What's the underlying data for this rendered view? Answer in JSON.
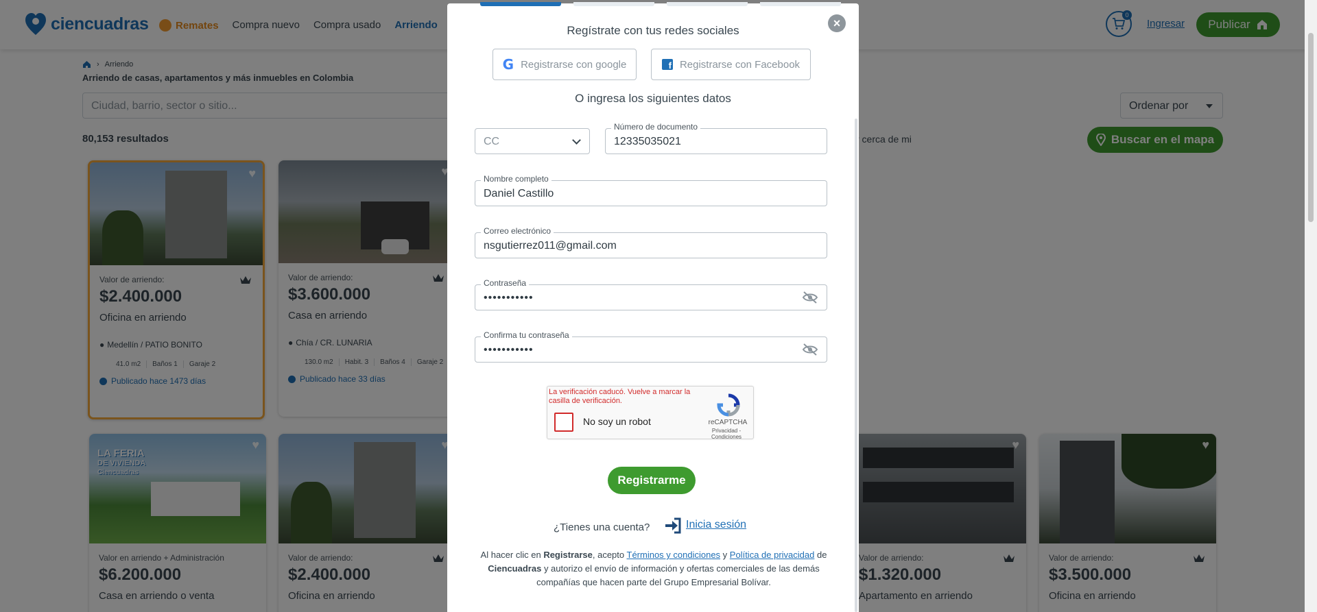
{
  "header": {
    "logo_text": "ciencuadras",
    "nav": [
      "Remates",
      "Compra nuevo",
      "Compra usado",
      "Arriendo"
    ],
    "cart_count": "0",
    "ingresar": "Ingresar",
    "publicar": "Publicar"
  },
  "breadcrumb": {
    "current": "Arriendo"
  },
  "subtitle": "Arriendo de casas, apartamentos y más inmuebles en Colombia",
  "search": {
    "placeholder": "Ciudad, barrio, sector o sitio..."
  },
  "sort": {
    "label": "Ordenar por"
  },
  "results_count": "80,153 resultados",
  "near_me": "r cerca de mi",
  "map_button": "Buscar en el mapa",
  "cards": [
    {
      "label": "Valor de arriendo:",
      "price": "$2.400.000",
      "type": "Oficina en arriendo",
      "location": "Medellín / PATIO BONITO",
      "features": [
        "41.0 m2",
        "Baños 1",
        "Garaje 2"
      ],
      "published": "Publicado hace 1473 días"
    },
    {
      "label": "Valor de arriendo:",
      "price": "$3.600.000",
      "type": "Casa en arriendo",
      "location": "Chía / CR. LUNARIA",
      "features": [
        "130.0 m2",
        "Habit. 3",
        "Baños 4",
        "Garaje 2"
      ],
      "published": "Publicado hace 33 días"
    },
    {
      "label": "Valor en arriendo + Administración",
      "price": "$6.200.000",
      "type": "Casa en arriendo o venta"
    },
    {
      "label": "Valor de arriendo:",
      "price": "$2.400.000",
      "type": "Oficina en arriendo"
    },
    {
      "label": "Valor de arriendo:",
      "price": "$1.320.000",
      "type": "Apartamento en arriendo"
    },
    {
      "label": "Valor de arriendo:",
      "price": "$3.500.000",
      "type": "Oficina en arriendo"
    }
  ],
  "feria_badge": {
    "line1": "LA FERIA",
    "line2": "DE VIVIENDA",
    "line3": "Ciencuadras"
  },
  "modal": {
    "social_title": "Regístrate con tus redes sociales",
    "google_button": "Registrarse con google",
    "facebook_button": "Registrarse con Facebook",
    "or_title": "O ingresa los siguientes datos",
    "doc_type": "CC",
    "doc_number_label": "Número de documento",
    "doc_number": "12335035021",
    "full_name_label": "Nombre completo",
    "full_name": "Daniel Castillo",
    "email_label": "Correo electrónico",
    "email": "nsgutierrez011@gmail.com",
    "password_label": "Contraseña",
    "password_mask": "•••••••••••",
    "confirm_label": "Confirma tu contraseña",
    "confirm_mask": "•••••••••••",
    "captcha": {
      "error": "La verificación caducó. Vuelve a marcar la casilla de verificación.",
      "text": "No soy un robot",
      "brand": "reCAPTCHA",
      "links": "Privacidad - Condiciones"
    },
    "submit": "Registrarme",
    "have_account": "¿Tienes una cuenta?",
    "login_link": "Inicia sesión",
    "legal": {
      "p1": "Al hacer clic en ",
      "b1": "Registrarse",
      "p2": ", acepto ",
      "terms": "Términos y condiciones",
      "p3": " y ",
      "privacy": "Política de privacidad",
      "p4": " de ",
      "b2": "Ciencuadras",
      "p5": " y autorizo el envío de información y ofertas comerciales de las demás compañías que hacen parte del Grupo Empresarial Bolívar."
    }
  },
  "colors": {
    "brand_blue": "#1f6fb5",
    "brand_green": "#3e9b2f",
    "remates_orange": "#e68a1c",
    "error_red": "#d12a2a"
  }
}
